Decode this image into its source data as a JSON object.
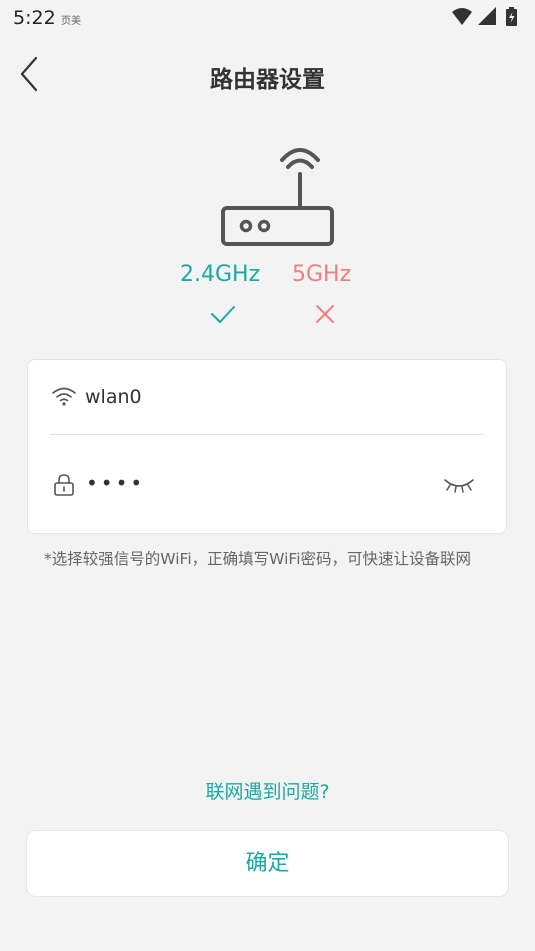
{
  "status_bar": {
    "time": "5:22",
    "app_label": "页美",
    "icons": [
      "wifi-icon",
      "signal-icon",
      "battery-charging-icon"
    ]
  },
  "header": {
    "title": "路由器设置",
    "back_icon": "chevron-left-icon"
  },
  "router": {
    "icon": "router-icon",
    "bands": [
      {
        "label": "2.4GHz",
        "status": "supported",
        "mark_icon": "check-icon",
        "color": "#1aa8a8"
      },
      {
        "label": "5GHz",
        "status": "unsupported",
        "mark_icon": "cross-icon",
        "color": "#ef7f7f"
      }
    ]
  },
  "form": {
    "ssid": {
      "icon": "wifi-icon",
      "value": "wlan0"
    },
    "password": {
      "icon": "lock-icon",
      "value": "••••",
      "toggle_icon": "eye-closed-icon"
    }
  },
  "hint": "*选择较强信号的WiFi，正确填写WiFi密码，可快速让设备联网",
  "help_link": "联网遇到问题?",
  "confirm_button": "确定",
  "colors": {
    "accent": "#1aa8a8",
    "error": "#ef7f7f",
    "background": "#f3f3f3"
  }
}
